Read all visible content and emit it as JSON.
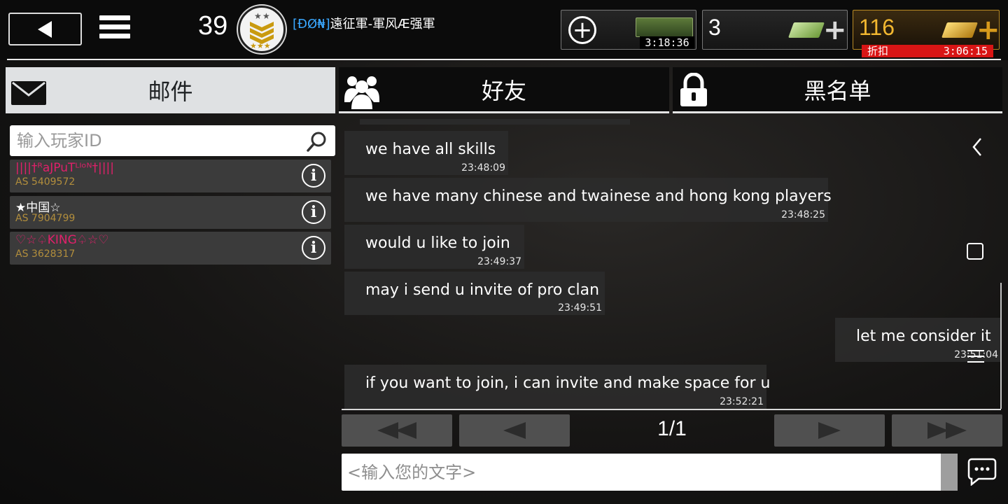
{
  "header": {
    "level": "39",
    "clan_tag": "[ĐØ₦]",
    "clan_name": "遠征軍-軍风Æ强軍",
    "crate_timer": "3:18:36",
    "cash_count": "3",
    "gold_count": "116",
    "discount_label": "折扣",
    "discount_timer": "3:06:15"
  },
  "tabs": [
    {
      "label": "邮件",
      "icon": "envelope-icon"
    },
    {
      "label": "好友",
      "icon": "friends-icon"
    },
    {
      "label": "黑名单",
      "icon": "lock-icon"
    }
  ],
  "search": {
    "placeholder": "输入玩家ID"
  },
  "players": [
    {
      "name": "||||†ᴿaJPuTᴸᴵᵒᴺ†||||",
      "id": "AS 5409572",
      "color": "#e0206a"
    },
    {
      "name": "★中国☆",
      "id": "AS 7904799",
      "color": "#ffffff"
    },
    {
      "name": "♡☆♤KING♤☆♡",
      "id": "AS 3628317",
      "color": "#e0206a"
    }
  ],
  "messages": [
    {
      "text": "we have all skills",
      "time": "23:48:09",
      "side": "left"
    },
    {
      "text": "we have many chinese and twainese and hong kong players",
      "time": "23:48:25",
      "side": "left"
    },
    {
      "text": "would u like to join",
      "time": "23:49:37",
      "side": "left"
    },
    {
      "text": "may i send u invite of pro clan",
      "time": "23:49:51",
      "side": "left"
    },
    {
      "text": "let me consider it",
      "time": "23:51:04",
      "side": "right"
    },
    {
      "text": "if you want to join, i can invite and make space for u",
      "time": "23:52:21",
      "side": "left"
    }
  ],
  "pager": {
    "indicator": "1/1"
  },
  "compose": {
    "placeholder": "<输入您的文字>"
  },
  "colors": {
    "clan_tag": "#3aa7ff",
    "gold": "#f2b730",
    "discount": "#d81515",
    "active_tab": "#dfe1e3"
  }
}
